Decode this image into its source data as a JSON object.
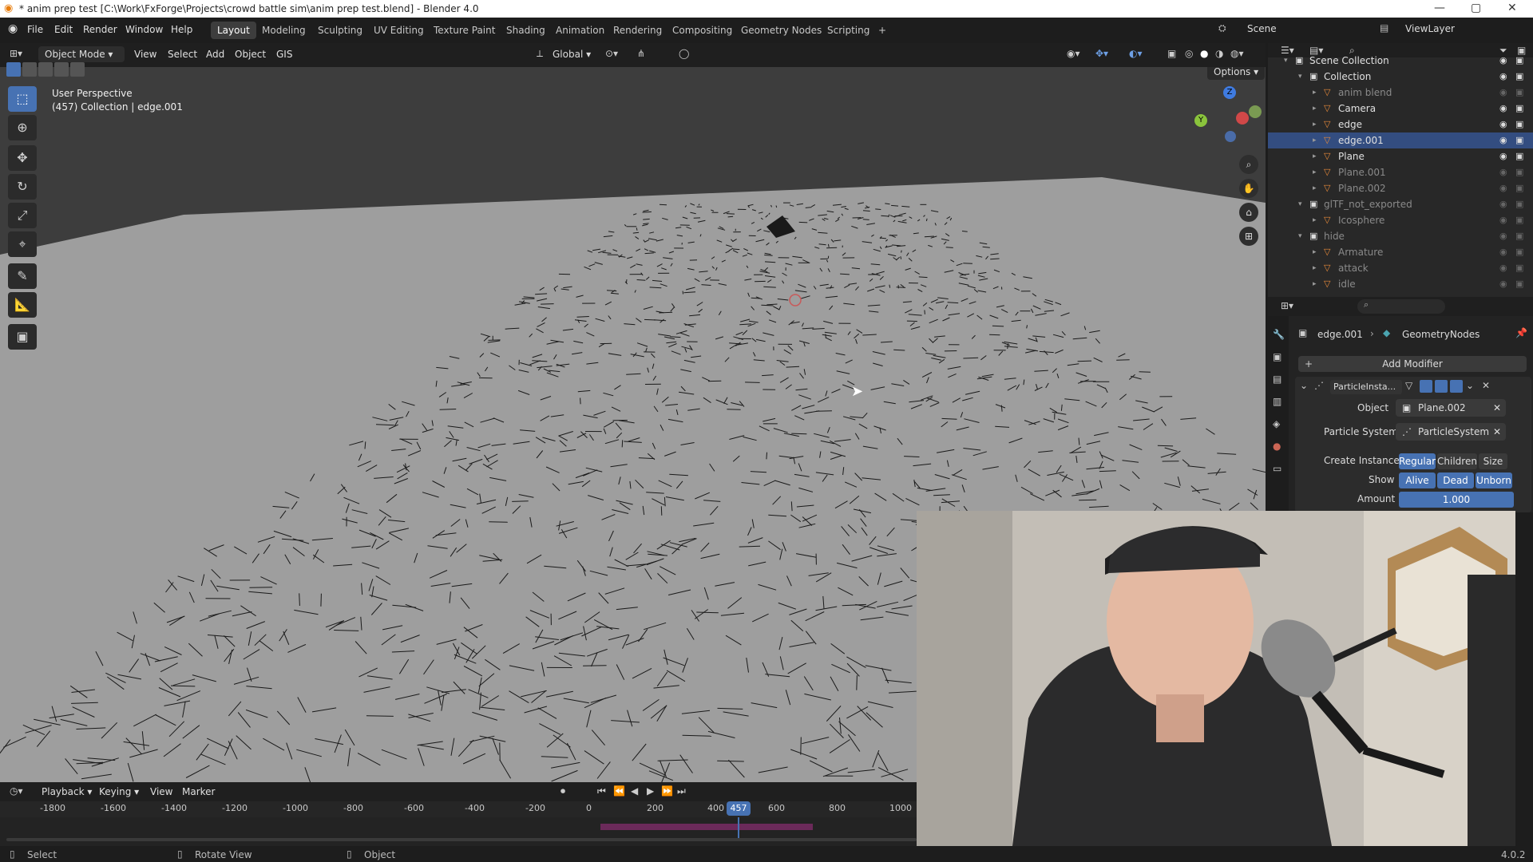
{
  "window": {
    "title": "* anim prep test [C:\\Work\\FxForge\\Projects\\crowd battle sim\\anim prep test.blend] - Blender 4.0"
  },
  "menu": [
    "File",
    "Edit",
    "Render",
    "Window",
    "Help"
  ],
  "workspaces": [
    "Layout",
    "Modeling",
    "Sculpting",
    "UV Editing",
    "Texture Paint",
    "Shading",
    "Animation",
    "Rendering",
    "Compositing",
    "Geometry Nodes",
    "Scripting",
    "+"
  ],
  "scene": {
    "label": "Scene",
    "viewlayer": "ViewLayer"
  },
  "viewport_header": {
    "mode": "Object Mode",
    "menus": [
      "View",
      "Select",
      "Add",
      "Object",
      "GIS"
    ],
    "orientation": "Global",
    "options": "Options"
  },
  "viewport": {
    "line1": "User Perspective",
    "line2": "(457) Collection | edge.001"
  },
  "outliner": {
    "rows": [
      {
        "label": "Scene Collection",
        "depth": 0,
        "dim": false
      },
      {
        "label": "Collection",
        "depth": 1,
        "dim": false
      },
      {
        "label": "anim blend",
        "depth": 2,
        "dim": true
      },
      {
        "label": "Camera",
        "depth": 2,
        "dim": false
      },
      {
        "label": "edge",
        "depth": 2,
        "dim": false
      },
      {
        "label": "edge.001",
        "depth": 2,
        "dim": false
      },
      {
        "label": "Plane",
        "depth": 2,
        "dim": false
      },
      {
        "label": "Plane.001",
        "depth": 2,
        "dim": true
      },
      {
        "label": "Plane.002",
        "depth": 2,
        "dim": true
      },
      {
        "label": "glTF_not_exported",
        "depth": 1,
        "dim": true
      },
      {
        "label": "Icosphere",
        "depth": 2,
        "dim": true
      },
      {
        "label": "hide",
        "depth": 1,
        "dim": true
      },
      {
        "label": "Armature",
        "depth": 2,
        "dim": true
      },
      {
        "label": "attack",
        "depth": 2,
        "dim": true
      },
      {
        "label": "idle",
        "depth": 2,
        "dim": true
      }
    ]
  },
  "properties": {
    "breadcrumb_object": "edge.001",
    "breadcrumb_modifier": "GeometryNodes",
    "add_modifier": "Add Modifier",
    "modifier_name": "ParticleInsta...",
    "object_label": "Object",
    "object_value": "Plane.002",
    "psys_label": "Particle System",
    "psys_value": "ParticleSystem",
    "create_label": "Create Instances",
    "create_opts": [
      "Regular",
      "Children",
      "Size"
    ],
    "show_label": "Show",
    "show_opts": [
      "Alive",
      "Dead",
      "Unborn"
    ],
    "amount_label": "Amount",
    "amount_value": "1.000"
  },
  "timeline": {
    "menus": [
      "Playback",
      "Keying",
      "View",
      "Marker"
    ],
    "ticks": [
      "-1800",
      "-1600",
      "-1400",
      "-1200",
      "-1000",
      "-800",
      "-600",
      "-400",
      "-200",
      "0",
      "200",
      "400",
      "600",
      "800",
      "1000"
    ],
    "current_frame": "457"
  },
  "status": {
    "select": "Select",
    "rotate": "Rotate View",
    "object": "Object",
    "version": "4.0.2"
  }
}
